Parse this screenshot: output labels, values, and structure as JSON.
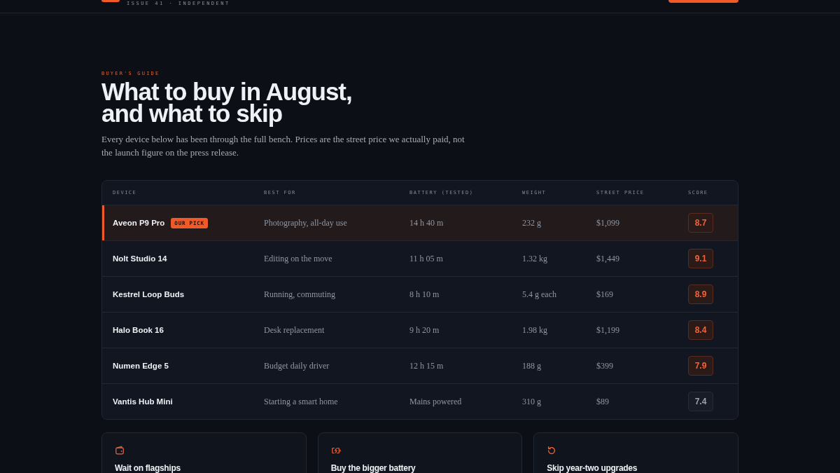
{
  "masthead": {
    "issue": "ISSUE 41 · INDEPENDENT"
  },
  "eyebrow": "BUYER'S GUIDE",
  "title_lines": [
    "What to buy in August,",
    "and what to skip"
  ],
  "intro": "Every device below has been through the full bench. Prices are the street price we actually paid, not the launch figure on the press release.",
  "table": {
    "columns": [
      "DEVICE",
      "BEST FOR",
      "BATTERY (TESTED)",
      "WEIGHT",
      "STREET PRICE",
      "SCORE"
    ],
    "rows": [
      {
        "device": "Aveon P9 Pro",
        "badge": "OUR PICK",
        "selected": true,
        "best_for": "Photography, all-day use",
        "battery": "14 h 40 m",
        "weight": "232 g",
        "price": "$1,099",
        "score": "8.7",
        "kind": "high"
      },
      {
        "device": "Nolt Studio 14",
        "selected": false,
        "best_for": "Editing on the move",
        "battery": "11 h 05 m",
        "weight": "1.32 kg",
        "price": "$1,449",
        "score": "9.1",
        "kind": "high"
      },
      {
        "device": "Kestrel Loop Buds",
        "selected": false,
        "best_for": "Running, commuting",
        "battery": "8 h 10 m",
        "weight": "5.4 g each",
        "price": "$169",
        "score": "8.9",
        "kind": "high"
      },
      {
        "device": "Halo Book 16",
        "selected": false,
        "best_for": "Desk replacement",
        "battery": "9 h 20 m",
        "weight": "1.98 kg",
        "price": "$1,199",
        "score": "8.4",
        "kind": "high"
      },
      {
        "device": "Numen Edge 5",
        "selected": false,
        "best_for": "Budget daily driver",
        "battery": "12 h 15 m",
        "weight": "188 g",
        "price": "$399",
        "score": "7.9",
        "kind": "high"
      },
      {
        "device": "Vantis Hub Mini",
        "selected": false,
        "best_for": "Starting a smart home",
        "battery": "Mains powered",
        "weight": "310 g",
        "price": "$89",
        "score": "7.4",
        "kind": "normal"
      }
    ]
  },
  "tips": [
    {
      "kind": "wallet",
      "title": "Wait on flagships"
    },
    {
      "kind": "battery",
      "title": "Buy the bigger battery"
    },
    {
      "kind": "refresh",
      "title": "Skip year-two upgrades"
    }
  ]
}
